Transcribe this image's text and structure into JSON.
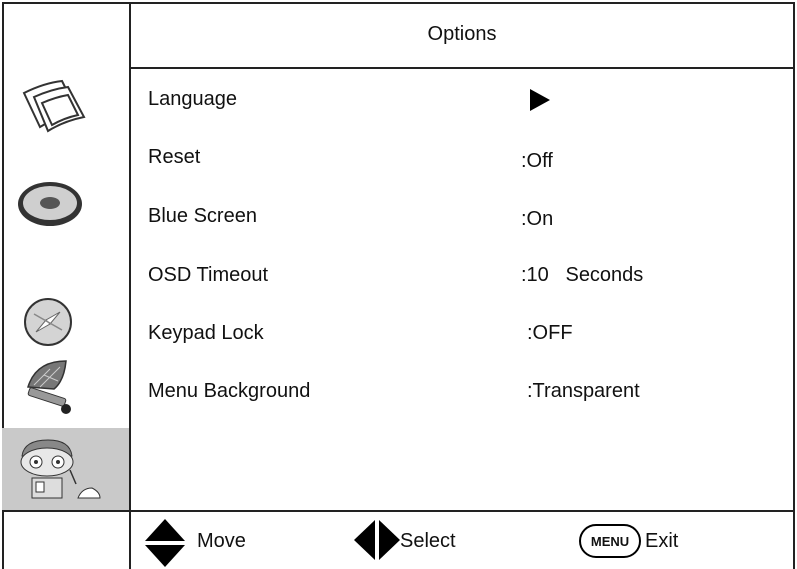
{
  "header": {
    "title": "Options"
  },
  "sidebar": {
    "icons": [
      {
        "name": "picture-icon"
      },
      {
        "name": "disc-icon"
      },
      {
        "name": "compass-icon"
      },
      {
        "name": "satellite-dish-icon"
      },
      {
        "name": "options-character-icon",
        "selected": true
      }
    ]
  },
  "options": [
    {
      "label": "Language",
      "value": "",
      "icon": "right-arrow-icon"
    },
    {
      "label": "Reset",
      "value": ":Off"
    },
    {
      "label": "Blue Screen",
      "value": ":On"
    },
    {
      "label": "OSD Timeout",
      "value": ":10   Seconds"
    },
    {
      "label": "Keypad Lock",
      "value": ":OFF"
    },
    {
      "label": "Menu Background",
      "value": ":Transparent"
    }
  ],
  "footer": {
    "move_label": "Move",
    "select_label": "Select",
    "menu_key": "MENU",
    "exit_label": "Exit"
  }
}
